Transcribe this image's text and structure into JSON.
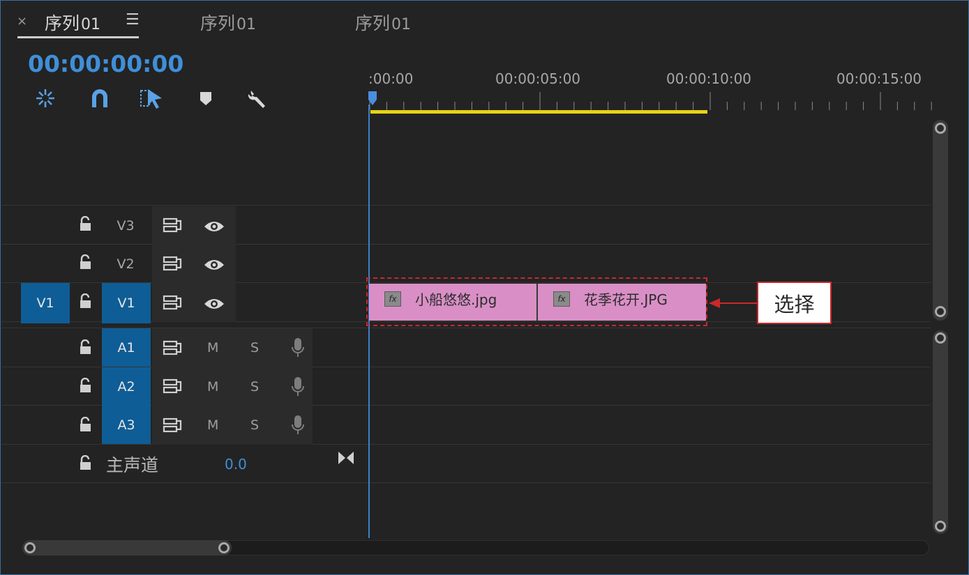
{
  "tabs": [
    {
      "label": "序列",
      "num": "01",
      "active": true
    },
    {
      "label": "序列",
      "num": "01",
      "active": false
    },
    {
      "label": "序列",
      "num": "01",
      "active": false
    }
  ],
  "tab_close": "×",
  "tab_menu": "☰",
  "timecode": "00:00:00:00",
  "tools": [
    "insert-overwrite-icon",
    "snap-magnet-icon",
    "linked-selection-icon",
    "add-marker-icon",
    "wrench-settings-icon"
  ],
  "ruler": [
    ":00:00",
    "00:00:05:00",
    "00:00:10:00",
    "00:00:15:00"
  ],
  "video_tracks": [
    {
      "name": "V3",
      "source_target": ""
    },
    {
      "name": "V2",
      "source_target": ""
    },
    {
      "name": "V1",
      "source_target": "V1"
    }
  ],
  "audio_tracks": [
    {
      "name": "A1",
      "m": "M",
      "s": "S"
    },
    {
      "name": "A2",
      "m": "M",
      "s": "S"
    },
    {
      "name": "A3",
      "m": "M",
      "s": "S"
    }
  ],
  "master": {
    "label": "主声道",
    "value": "0.0"
  },
  "clips": [
    {
      "fx": "fx",
      "name": "小船悠悠.jpg"
    },
    {
      "fx": "fx",
      "name": "花季花开.JPG"
    }
  ],
  "callout": "选择",
  "colors": {
    "accent_blue": "#3f8fd8",
    "track_target": "#0f5d96",
    "work_area": "#e6d414",
    "clip": "#d98fc6",
    "annotation": "#c8292d"
  }
}
